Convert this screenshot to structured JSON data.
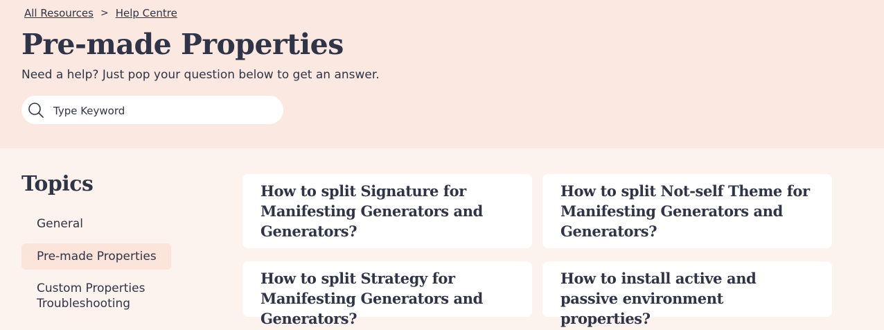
{
  "breadcrumb": {
    "items": [
      "All Resources",
      "Help Centre"
    ],
    "separator": ">"
  },
  "header": {
    "title": "Pre-made Properties",
    "subtitle": "Need a help? Just pop your question below to get an answer."
  },
  "search": {
    "placeholder": "Type Keyword",
    "value": "",
    "icon": "search-icon"
  },
  "sidebar": {
    "title": "Topics",
    "items": [
      {
        "label": "General",
        "active": false
      },
      {
        "label": "Pre-made Properties",
        "active": true
      },
      {
        "label": "Custom Properties Troubleshooting",
        "active": false
      }
    ]
  },
  "articles": [
    {
      "title": "How to split Signature for Manifesting Generators and Generators?"
    },
    {
      "title": "How to split Not-self Theme for Manifesting Generators and Generators?"
    },
    {
      "title": "How to split Strategy for Manifesting Generators and Generators?"
    },
    {
      "title": "How to install active and passive environment properties?"
    }
  ],
  "colors": {
    "hero_bg": "#fbe8e0",
    "page_bg": "#fdf3ee",
    "text": "#2f3446",
    "active_topic_bg": "#fbe4da",
    "card_bg": "#ffffff"
  }
}
